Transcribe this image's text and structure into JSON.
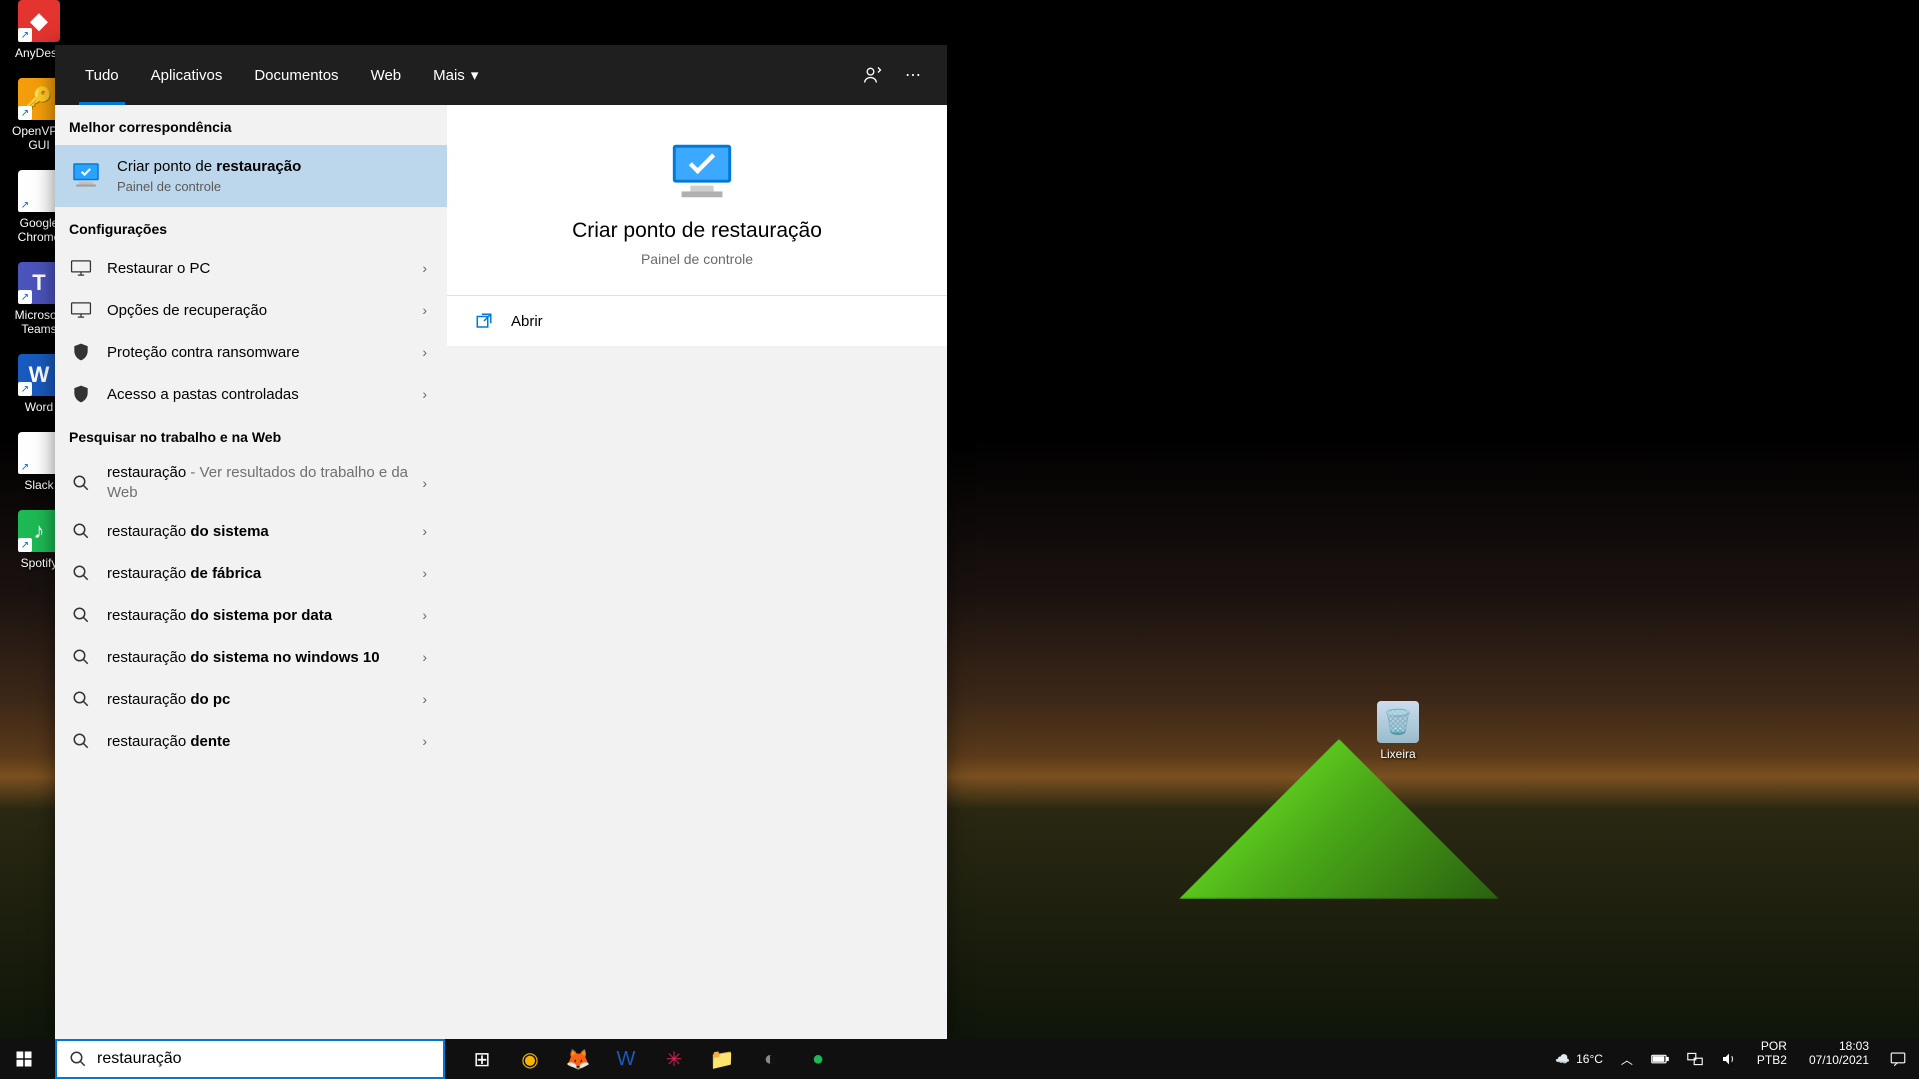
{
  "desktop_icons": [
    {
      "label": "AnyDesk",
      "bg": "#e3342f",
      "glyph": "◆"
    },
    {
      "label": "OpenVPN GUI",
      "bg": "#f59e0b",
      "glyph": "🔑"
    },
    {
      "label": "Google Chrome",
      "bg": "#fff",
      "glyph": "◉"
    },
    {
      "label": "Microsoft Teams",
      "bg": "#4b53bc",
      "glyph": "T"
    },
    {
      "label": "Word",
      "bg": "#185abd",
      "glyph": "W"
    },
    {
      "label": "Slack",
      "bg": "#fff",
      "glyph": "✳"
    },
    {
      "label": "Spotify",
      "bg": "#1db954",
      "glyph": "♪"
    }
  ],
  "recycle": {
    "label": "Lixeira"
  },
  "search": {
    "tabs": {
      "all": "Tudo",
      "apps": "Aplicativos",
      "docs": "Documentos",
      "web": "Web",
      "more": "Mais"
    },
    "best_match_header": "Melhor correspondência",
    "best_match": {
      "title_prefix": "Criar ponto de ",
      "title_bold": "restauração",
      "subtitle": "Painel de controle"
    },
    "settings_header": "Configurações",
    "settings_items": [
      {
        "label": "Restaurar o PC",
        "icon": "pc"
      },
      {
        "label": "Opções de recuperação",
        "icon": "pc"
      },
      {
        "label": "Proteção contra ransomware",
        "icon": "shield"
      },
      {
        "label": "Acesso a pastas controladas",
        "icon": "shield"
      }
    ],
    "web_header": "Pesquisar no trabalho e na Web",
    "web_items": [
      {
        "prefix": "restauração",
        "suffix": " - Ver resultados do trabalho e da Web",
        "bold": ""
      },
      {
        "prefix": "restauração ",
        "bold": "do sistema"
      },
      {
        "prefix": "restauração ",
        "bold": "de fábrica"
      },
      {
        "prefix": "restauração ",
        "bold": "do sistema por data"
      },
      {
        "prefix": "restauração ",
        "bold": "do sistema no windows 10"
      },
      {
        "prefix": "restauração ",
        "bold": "do pc"
      },
      {
        "prefix": "restauração ",
        "bold": "dente"
      }
    ],
    "preview": {
      "title": "Criar ponto de restauração",
      "subtitle": "Painel de controle"
    },
    "actions": {
      "open": "Abrir"
    },
    "query": "restauração"
  },
  "taskbar": {
    "apps": [
      {
        "name": "task-view",
        "glyph": "⊞",
        "color": "#fff"
      },
      {
        "name": "chrome",
        "glyph": "◉",
        "color": "#f4b400"
      },
      {
        "name": "firefox",
        "glyph": "🦊",
        "color": "#ff7139"
      },
      {
        "name": "word",
        "glyph": "W",
        "color": "#185abd"
      },
      {
        "name": "slack",
        "glyph": "✳",
        "color": "#e01e5a"
      },
      {
        "name": "explorer",
        "glyph": "📁",
        "color": "#ffca28"
      },
      {
        "name": "photoscape",
        "glyph": "◐",
        "color": "#888"
      },
      {
        "name": "spotify",
        "glyph": "●",
        "color": "#1db954"
      }
    ],
    "weather": "16°C",
    "lang1": "POR",
    "lang2": "PTB2",
    "time": "18:03",
    "date": "07/10/2021"
  }
}
